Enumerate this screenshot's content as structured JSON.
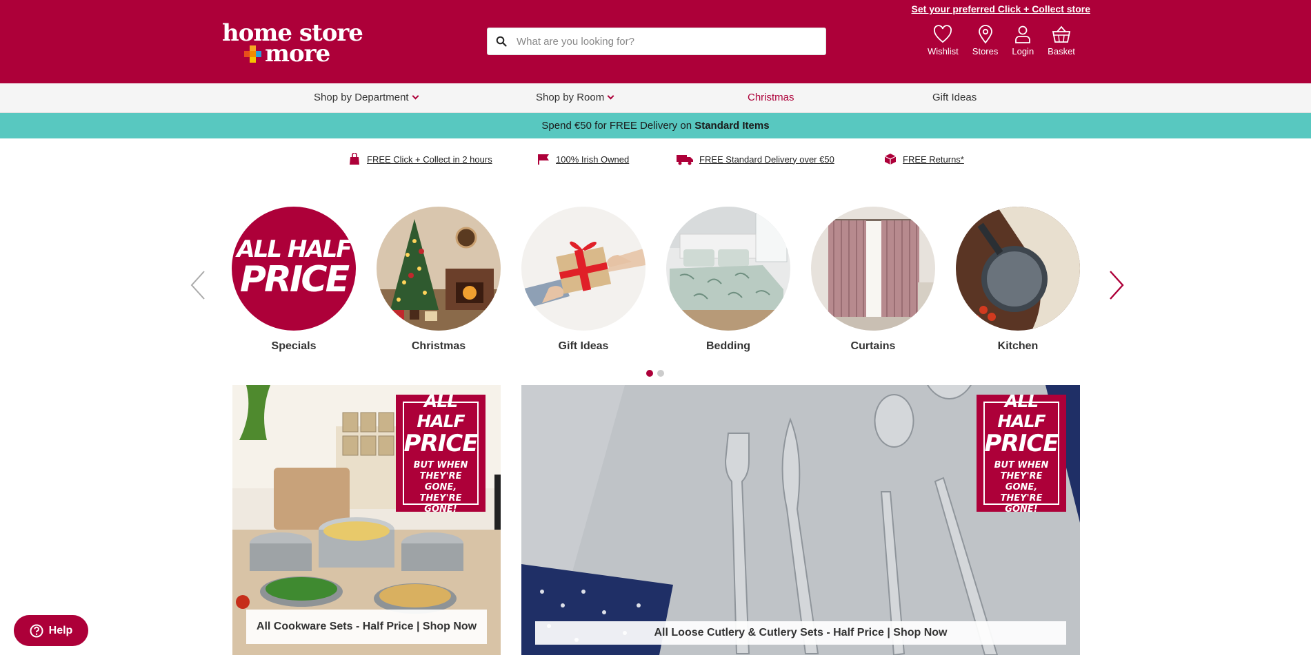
{
  "header": {
    "logo_line1": "home store",
    "logo_line2": "more",
    "collect_link": "Set your preferred Click + Collect store",
    "search_placeholder": "What are you looking for?",
    "icons": {
      "wishlist": "Wishlist",
      "stores": "Stores",
      "login": "Login",
      "basket": "Basket"
    },
    "brand_color": "#ad0039"
  },
  "nav": {
    "items": [
      {
        "label": "Shop by Department"
      },
      {
        "label": "Shop by Room"
      },
      {
        "label": "Christmas"
      },
      {
        "label": "Gift Ideas"
      }
    ]
  },
  "promo": {
    "text": "Spend €50 for FREE Delivery on ",
    "bold": "Standard Items",
    "color": "#58c8c0"
  },
  "usps": [
    {
      "label": "FREE Click + Collect in 2 hours",
      "icon": "shopping-bag-icon"
    },
    {
      "label": "100% Irish Owned",
      "icon": "flag-icon"
    },
    {
      "label": "FREE Standard Delivery over €50",
      "icon": "truck-icon"
    },
    {
      "label": "FREE Returns*",
      "icon": "box-icon"
    }
  ],
  "carousel": {
    "categories": [
      {
        "label": "Specials",
        "badge_line1": "ALL HALF",
        "badge_line2": "PRICE"
      },
      {
        "label": "Christmas"
      },
      {
        "label": "Gift Ideas"
      },
      {
        "label": "Bedding"
      },
      {
        "label": "Curtains"
      },
      {
        "label": "Kitchen"
      }
    ],
    "page": 1,
    "pages": 2
  },
  "banners": [
    {
      "caption": "All Cookware Sets - Half Price | Shop Now",
      "sticker_line1": "ALL HALF",
      "sticker_line2": "PRICE",
      "sticker_small": "BUT WHEN THEY'RE GONE, THEY'RE GONE!"
    },
    {
      "caption": "All Loose Cutlery & Cutlery Sets - Half Price | Shop Now",
      "sticker_line1": "ALL HALF",
      "sticker_line2": "PRICE",
      "sticker_small": "BUT WHEN THEY'RE GONE, THEY'RE GONE!"
    }
  ],
  "help": {
    "label": "Help"
  }
}
